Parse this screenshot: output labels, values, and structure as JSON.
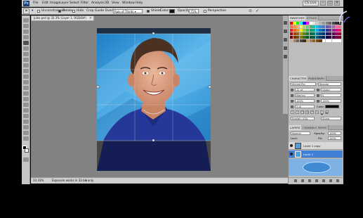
{
  "menubar": {
    "items": [
      "File",
      "Edit",
      "Image",
      "Layer",
      "Select",
      "Filter",
      "Analysis",
      "3D",
      "View",
      "Window",
      "Help"
    ],
    "workspace_button": "CS Live"
  },
  "options": {
    "unconstrained": "Unconstrained",
    "delete_label": "Delete",
    "hide_label": "Hide",
    "crop_guide_label": "Crop Guide Overlay:",
    "crop_guide_value": "Rule of Thirds",
    "shield_label": "Shield",
    "color_label": "Color:",
    "opacity_label": "Opacity:",
    "opacity_value": "75%",
    "perspective_label": "Perspective",
    "cancel_glyph": "⊘",
    "commit_glyph": "✓"
  },
  "document": {
    "tab_title": "Jules.psd @ 33.3% (Layer 1, RGB/8#)"
  },
  "status": {
    "zoom": "33.33%",
    "info": "Exposure works in 32-bit only"
  },
  "swatches_panel": {
    "tab_active": "SWATCHES",
    "tab_inactive": "STYLES"
  },
  "character_panel": {
    "tab_active": "CHARACTER",
    "tab_inactive": "PARAGRAPH",
    "font_family": "Myriad Pro",
    "font_style": "Regular",
    "font_size": "12 pt",
    "leading": "(Auto)",
    "kerning": "Metrics",
    "tracking": "0",
    "vscale": "100%",
    "hscale": "100%",
    "baseline": "0 pt",
    "color_label": "Color:",
    "language": "English: USA",
    "antialias": "Sharp"
  },
  "layers_panel": {
    "tabs": [
      "LAYERS",
      "CHANNELS",
      "PATHS"
    ],
    "blend_mode": "Normal",
    "opacity_label": "Opacity:",
    "opacity_value": "100%",
    "fill_label": "Fill:",
    "fill_value": "100%",
    "lock_label": "Lock:",
    "layers": [
      {
        "name": "Layer 1 copy"
      },
      {
        "name": "Layer 1"
      }
    ]
  },
  "colors": {
    "chrome": "#c6c6c6",
    "selected_layer": "#3f7fd6",
    "canvas_bg": "#828282"
  }
}
